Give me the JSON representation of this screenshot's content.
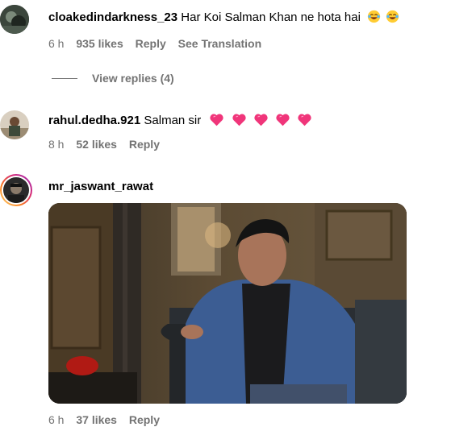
{
  "comments": [
    {
      "username": "cloakedindarkness_23",
      "text": "Har Koi Salman Khan ne hota hai",
      "emojis": [
        "rolling-laughing",
        "rolling-laughing"
      ],
      "time": "6 h",
      "likes": "935 likes",
      "reply": "Reply",
      "translate": "See Translation",
      "view_replies": "View replies (4)"
    },
    {
      "username": "rahul.dedha.921",
      "text": "Salman sir",
      "emojis": [
        "pink-heart",
        "pink-heart",
        "pink-heart",
        "pink-heart",
        "pink-heart"
      ],
      "time": "8 h",
      "likes": "52 likes",
      "reply": "Reply"
    },
    {
      "username": "mr_jaswant_rawat",
      "attachment": "gif",
      "time": "6 h",
      "likes": "37 likes",
      "reply": "Reply"
    }
  ],
  "colors": {
    "meta_text": "#737373",
    "heart": "#f0357a",
    "story_ring_start": "#feda75",
    "story_ring_end": "#d62976"
  }
}
